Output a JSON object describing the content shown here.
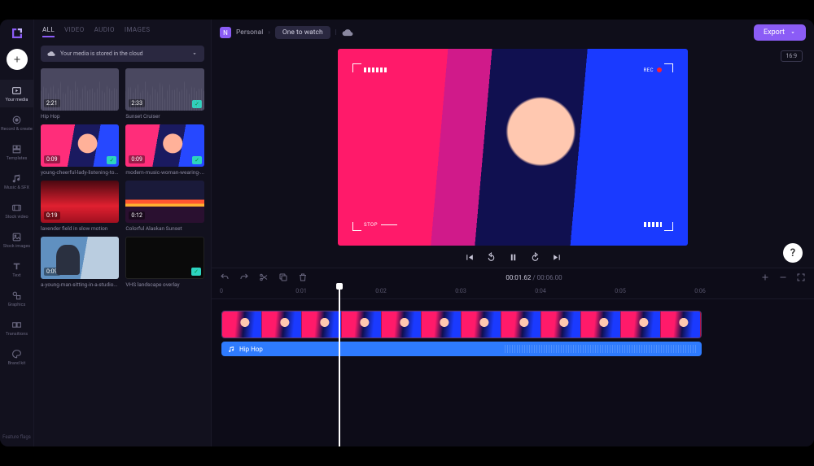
{
  "rail": {
    "items": [
      {
        "label": "Your media"
      },
      {
        "label": "Record & create"
      },
      {
        "label": "Templates"
      },
      {
        "label": "Music & SFX"
      },
      {
        "label": "Stock video"
      },
      {
        "label": "Stock images"
      },
      {
        "label": "Text"
      },
      {
        "label": "Graphics"
      },
      {
        "label": "Transitions"
      },
      {
        "label": "Brand kit"
      }
    ],
    "bottom": "Feature flags"
  },
  "tabs": {
    "all": "ALL",
    "video": "VIDEO",
    "audio": "AUDIO",
    "images": "IMAGES"
  },
  "cloud_msg": "Your media is stored in the cloud",
  "media": [
    {
      "dur": "2:21",
      "label": "Hip Hop",
      "checked": false,
      "art": "t-wave"
    },
    {
      "dur": "2:33",
      "label": "Sunset Cruiser",
      "checked": true,
      "art": "t-wave"
    },
    {
      "dur": "0:09",
      "label": "young-cheerful-lady-listening-to...",
      "checked": true,
      "art": "t-face"
    },
    {
      "dur": "0:09",
      "label": "modern-music-woman-wearing-...",
      "checked": true,
      "art": "t-face"
    },
    {
      "dur": "0:19",
      "label": "lavender field in slow motion",
      "checked": false,
      "art": "t-red"
    },
    {
      "dur": "0:12",
      "label": "Colorful Alaskan Sunset",
      "checked": false,
      "art": "t-sunset"
    },
    {
      "dur": "0:09",
      "label": "a-young-man-sitting-in-a-studio...",
      "checked": false,
      "art": "t-man"
    },
    {
      "dur": "",
      "label": "VHS landscape overlay",
      "checked": true,
      "art": "t-vhs"
    }
  ],
  "workspace": {
    "badge": "N",
    "name": "Personal"
  },
  "project": "One to watch",
  "export_label": "Export",
  "aspect": "16:9",
  "overlay": {
    "tl_text": "",
    "tr_text": "REC",
    "bl_text": "STOP",
    "br_text": ""
  },
  "timecode": {
    "current": "00:01.62",
    "total": "00:06.00",
    "sep": " / "
  },
  "ruler": [
    "0",
    "0:01",
    "0:02",
    "0:03",
    "0:04",
    "0:05",
    "0:06"
  ],
  "audio_clip": {
    "label": "Hip Hop"
  },
  "help": "?"
}
